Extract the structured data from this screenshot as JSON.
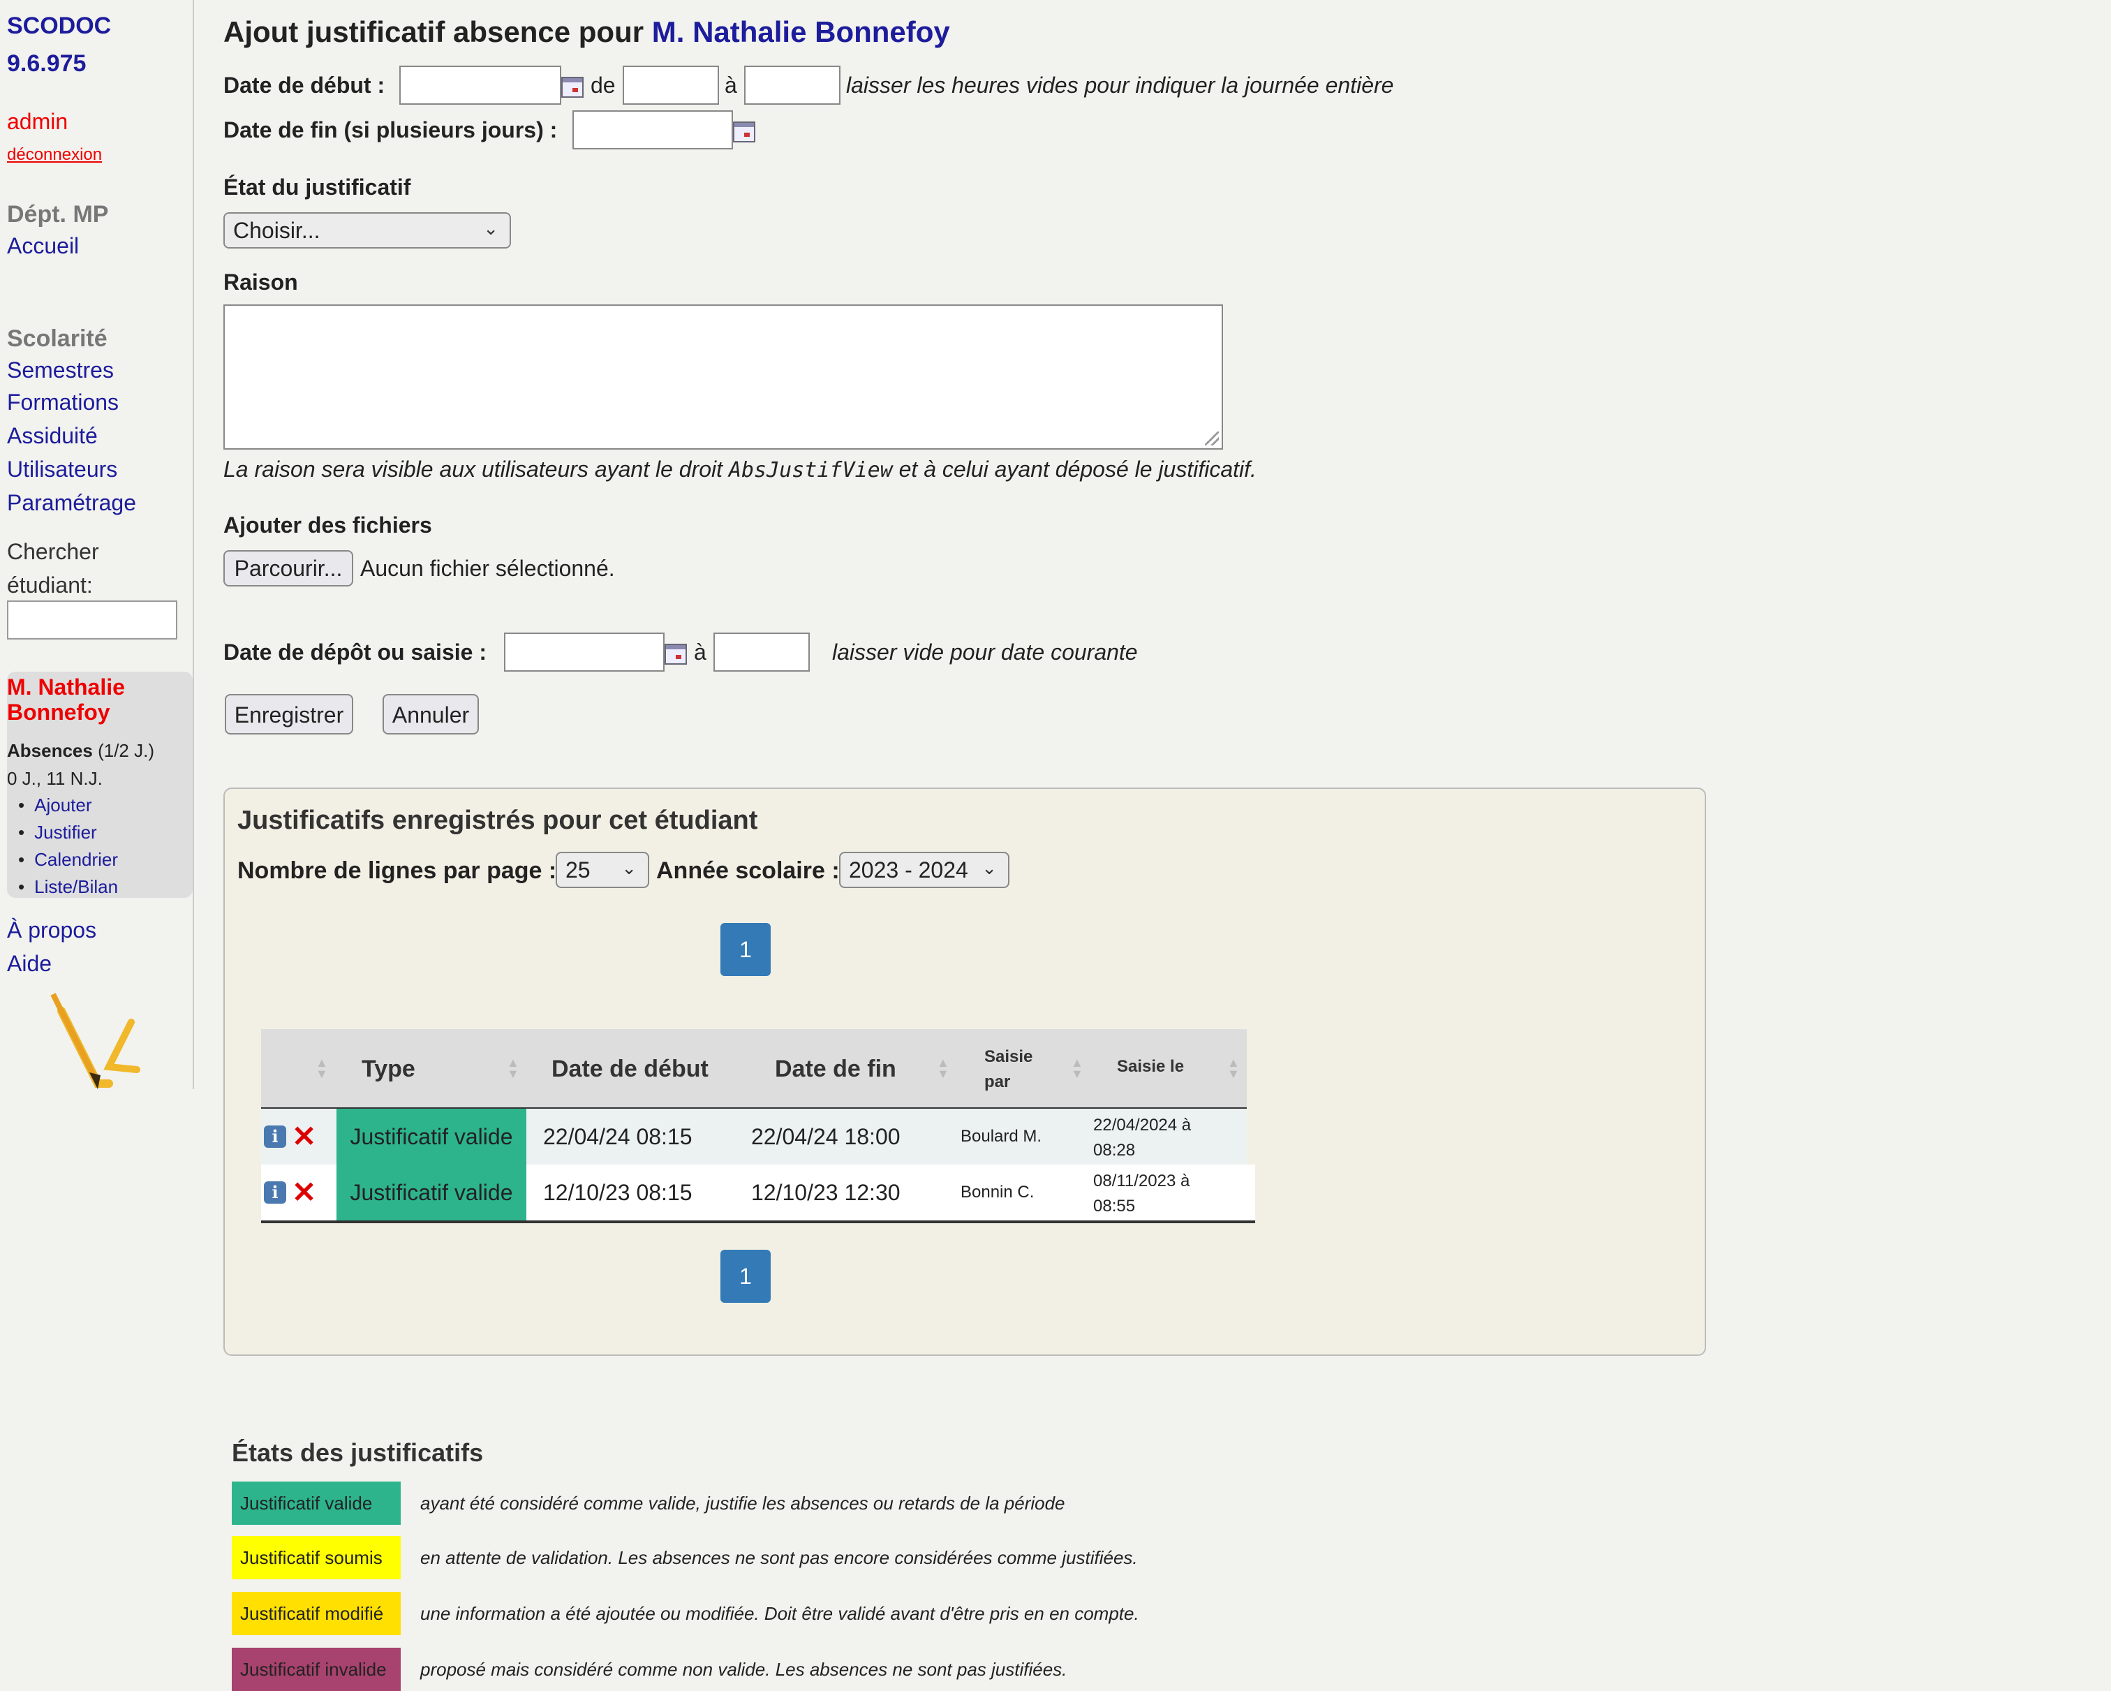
{
  "sidebar": {
    "brand_line1": "SCODOC",
    "brand_line2": "9.6.975",
    "user": "admin",
    "logout": "déconnexion",
    "dept": "Dépt. MP",
    "home": "Accueil",
    "scolarite_heading": "Scolarité",
    "nav": [
      "Semestres",
      "Formations",
      "Assiduité",
      "Utilisateurs",
      "Paramétrage"
    ],
    "search_label_1": "Chercher",
    "search_label_2": "étudiant:",
    "search_value": "",
    "student": {
      "name": "M. Nathalie Bonnefoy",
      "absences_label": "Absences",
      "absences_unit": "(1/2 J.)",
      "counts": "0 J., 11 N.J.",
      "links": [
        "Ajouter",
        "Justifier",
        "Calendrier",
        "Liste/Bilan"
      ]
    },
    "about": "À propos",
    "help": "Aide"
  },
  "form": {
    "title_prefix": "Ajout justificatif absence pour",
    "title_name": "M. Nathalie Bonnefoy",
    "date_debut_label": "Date de début :",
    "de": "de",
    "a": "à",
    "hours_hint": "laisser les heures vides pour indiquer la journée entière",
    "date_fin_label": "Date de fin (si plusieurs jours) :",
    "etat_label": "État du justificatif",
    "etat_value": "Choisir...",
    "raison_label": "Raison",
    "raison_value": "",
    "raison_hint_1": "La raison sera visible aux utilisateurs ayant le droit",
    "raison_hint_code": "AbsJustifView",
    "raison_hint_2": "et à celui ayant déposé le justificatif.",
    "files_label": "Ajouter des fichiers",
    "browse_button": "Parcourir...",
    "no_file": "Aucun fichier sélectionné.",
    "depot_label": "Date de dépôt ou saisie :",
    "depot_a": "à",
    "depot_hint": "laisser vide pour date courante",
    "save_button": "Enregistrer",
    "cancel_button": "Annuler"
  },
  "justifs": {
    "title": "Justificatifs enregistrés pour cet étudiant",
    "rows_per_page_label": "Nombre de lignes par page :",
    "rows_per_page_value": "25",
    "year_label": "Année scolaire :",
    "year_value": "2023 - 2024",
    "page": "1",
    "columns": [
      "Type",
      "Date de début",
      "Date de fin",
      "Saisie par",
      "Saisie le"
    ],
    "rows": [
      {
        "type": "Justificatif valide",
        "debut": "22/04/24 08:15",
        "fin": "22/04/24 18:00",
        "par": "Boulard M.",
        "le_1": "22/04/2024 à",
        "le_2": "08:28"
      },
      {
        "type": "Justificatif valide",
        "debut": "12/10/23 08:15",
        "fin": "12/10/23 12:30",
        "par": "Bonnin C.",
        "le_1": "08/11/2023 à",
        "le_2": "08:55"
      }
    ]
  },
  "legend": {
    "title": "États des justificatifs",
    "items": [
      {
        "label": "Justificatif valide",
        "color": "#2db48d",
        "text": "ayant été considéré comme valide, justifie les absences ou retards de la période"
      },
      {
        "label": "Justificatif soumis",
        "color": "#ffff00",
        "text": "en attente de validation. Les absences ne sont pas encore considérées comme justifiées."
      },
      {
        "label": "Justificatif modifié",
        "color": "#ffe000",
        "text": "une information a été ajoutée ou modifiée. Doit être validé avant d'être pris en en compte."
      },
      {
        "label": "Justificatif invalide",
        "color": "#a8426e",
        "text": "proposé mais considéré comme non valide. Les absences ne sont pas justifiées."
      }
    ]
  },
  "colors": {
    "link": "#1c1c9c",
    "alert": "#e00000",
    "pager": "#337ab7"
  },
  "icons": [
    "calendar-icon",
    "info-icon",
    "delete-icon",
    "sort-icon",
    "chevron-down-icon",
    "logo-icon"
  ]
}
